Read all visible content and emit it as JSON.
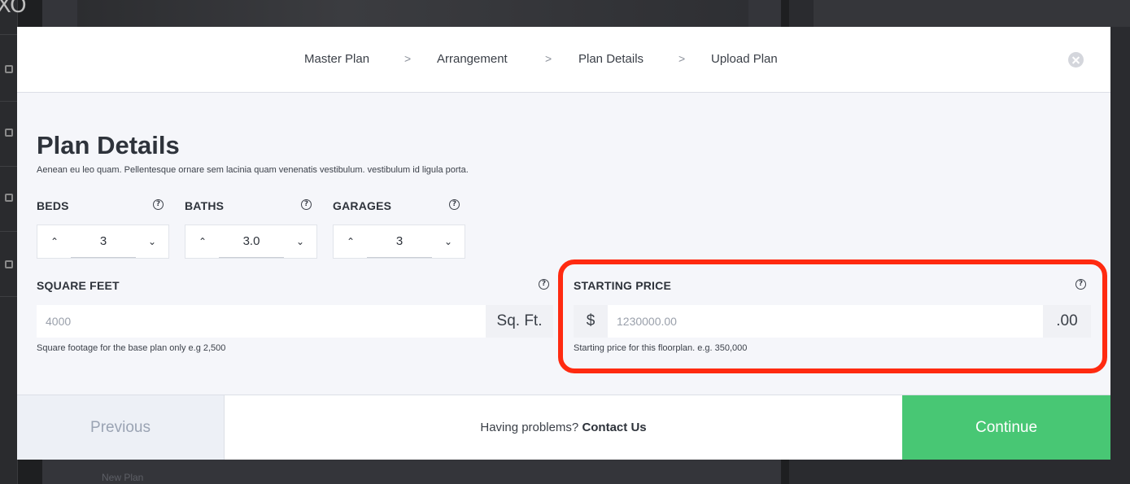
{
  "background": {
    "logo": "XO",
    "list_item": "New Plan"
  },
  "breadcrumb": {
    "steps": [
      "Master Plan",
      "Arrangement",
      "Plan Details",
      "Upload Plan"
    ],
    "separator": ">"
  },
  "page": {
    "title": "Plan Details",
    "description": "Aenean eu leo quam. Pellentesque ornare sem lacinia quam venenatis vestibulum. vestibulum id ligula porta."
  },
  "fields": {
    "beds": {
      "label": "BEDS",
      "value": "3"
    },
    "baths": {
      "label": "BATHS",
      "value": "3.0"
    },
    "garages": {
      "label": "GARAGES",
      "value": "3"
    },
    "square_feet": {
      "label": "SQUARE FEET",
      "placeholder": "4000",
      "suffix": "Sq. Ft.",
      "hint": "Square footage for the base plan only e.g 2,500"
    },
    "starting_price": {
      "label": "STARTING PRICE",
      "prefix": "$",
      "placeholder": "1230000.00",
      "suffix": ".00",
      "hint": "Starting price for this floorplan. e.g. 350,000"
    }
  },
  "icons": {
    "help": "?",
    "chevron_up": "⌃",
    "chevron_down": "⌄"
  },
  "footer": {
    "previous_label": "Previous",
    "help_prefix": "Having problems?",
    "help_link": "Contact Us",
    "continue_label": "Continue"
  },
  "colors": {
    "accent_green": "#48c774",
    "highlight_red": "#ff2a10",
    "modal_background": "#f5f6fa"
  }
}
